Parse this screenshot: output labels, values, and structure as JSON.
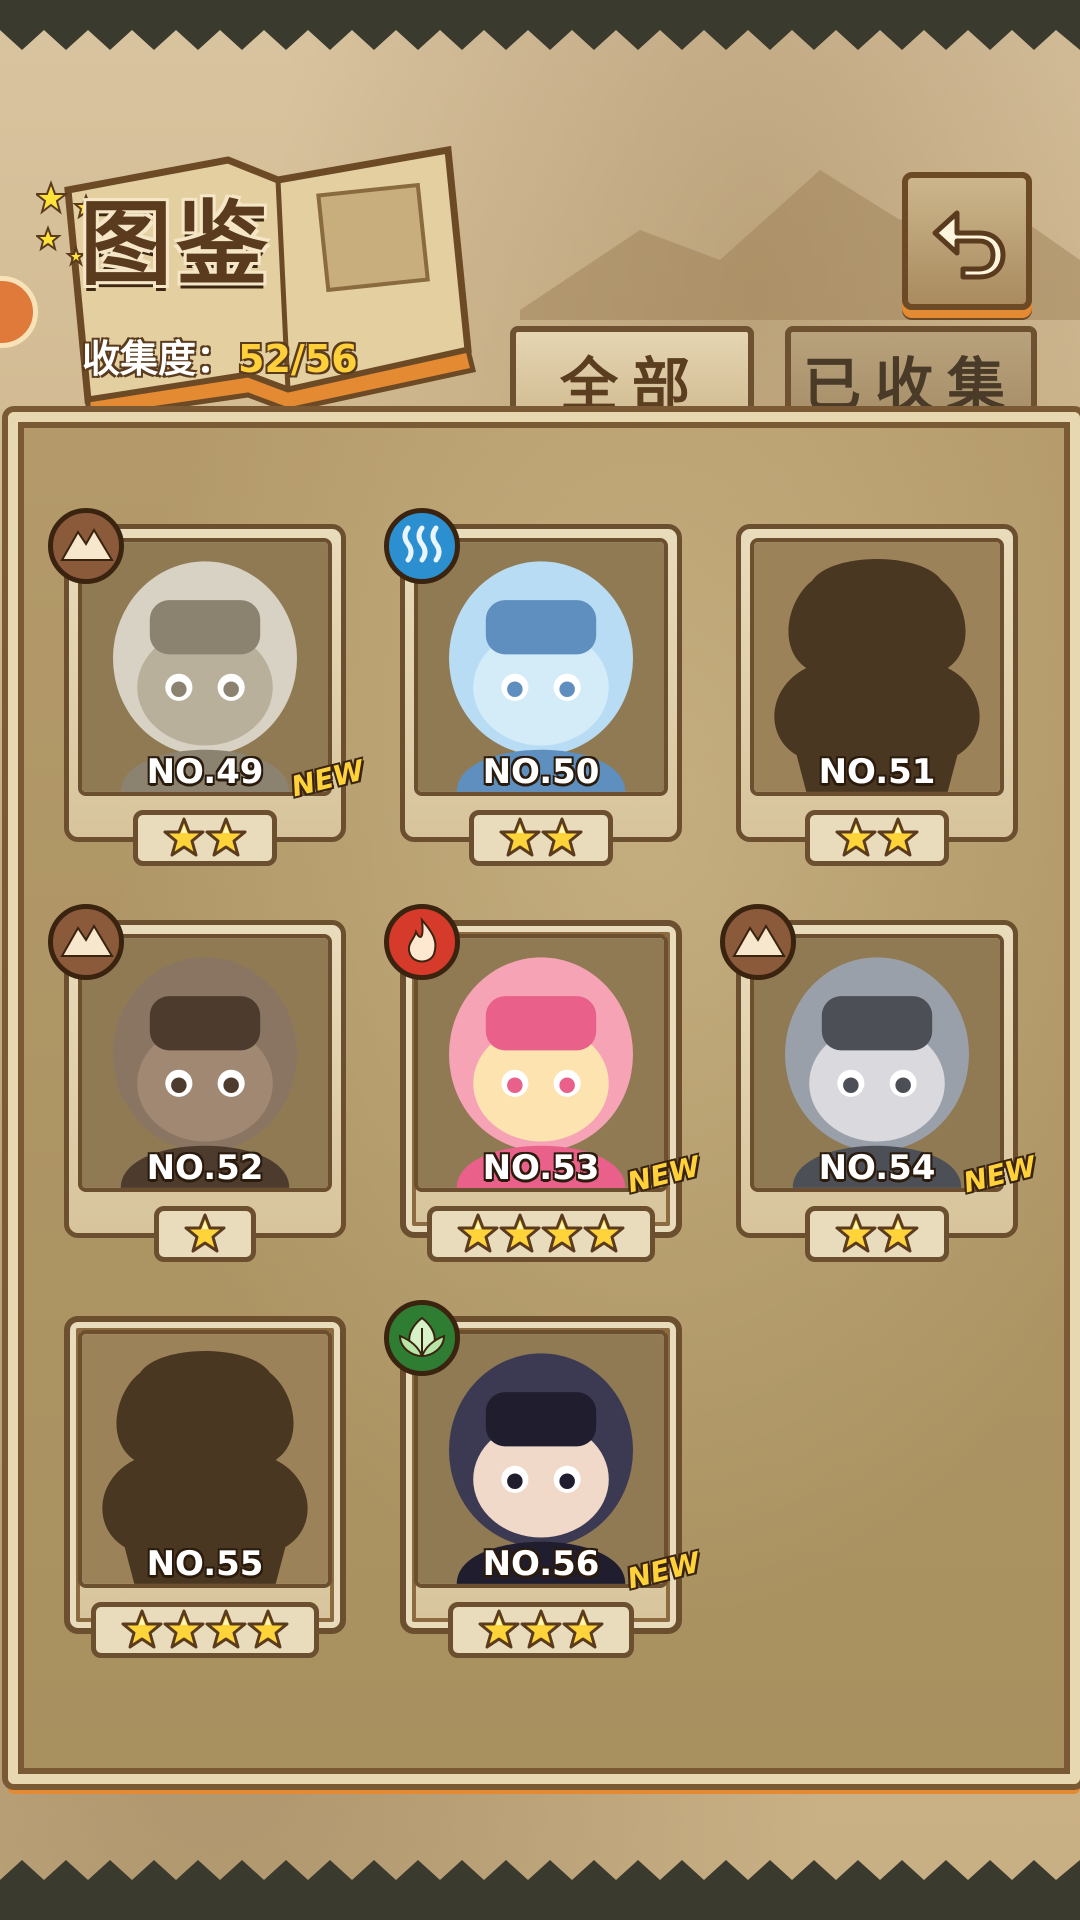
{
  "header": {
    "title": "图鉴",
    "collection_label": "收集度：",
    "collection_value": "52/56"
  },
  "tabs": [
    {
      "label": "全部",
      "active": true
    },
    {
      "label": "已收集",
      "active": false
    }
  ],
  "cards": [
    {
      "number": "NO.49",
      "stars": 2,
      "new": true,
      "element": "earth",
      "unlocked": true,
      "palette": "stone"
    },
    {
      "number": "NO.50",
      "stars": 2,
      "new": false,
      "element": "water",
      "unlocked": true,
      "palette": "ice"
    },
    {
      "number": "NO.51",
      "stars": 2,
      "new": false,
      "element": null,
      "unlocked": false,
      "palette": "silhouette"
    },
    {
      "number": "NO.52",
      "stars": 1,
      "new": false,
      "element": "earth",
      "unlocked": true,
      "palette": "mud"
    },
    {
      "number": "NO.53",
      "stars": 4,
      "new": true,
      "element": "fire",
      "unlocked": true,
      "palette": "pink"
    },
    {
      "number": "NO.54",
      "stars": 2,
      "new": true,
      "element": "earth",
      "unlocked": true,
      "palette": "grey"
    },
    {
      "number": "NO.55",
      "stars": 4,
      "new": false,
      "element": null,
      "unlocked": false,
      "palette": "silhouette"
    },
    {
      "number": "NO.56",
      "stars": 3,
      "new": true,
      "element": "wood",
      "unlocked": true,
      "palette": "dark"
    }
  ],
  "new_badge_label": "NEW",
  "icons": {
    "back": "return-arrow-icon",
    "side": "arrow-right-icon",
    "star": "star-icon",
    "earth": "mountain-icon",
    "water": "water-waves-icon",
    "fire": "flame-icon",
    "wood": "leaf-icon"
  },
  "colors": {
    "earth": "#8a5a3a",
    "water": "#2b8fd0",
    "fire": "#d63a2a",
    "wood": "#2f7d32",
    "accent": "#e48a32",
    "gold": "#ffd03a"
  }
}
